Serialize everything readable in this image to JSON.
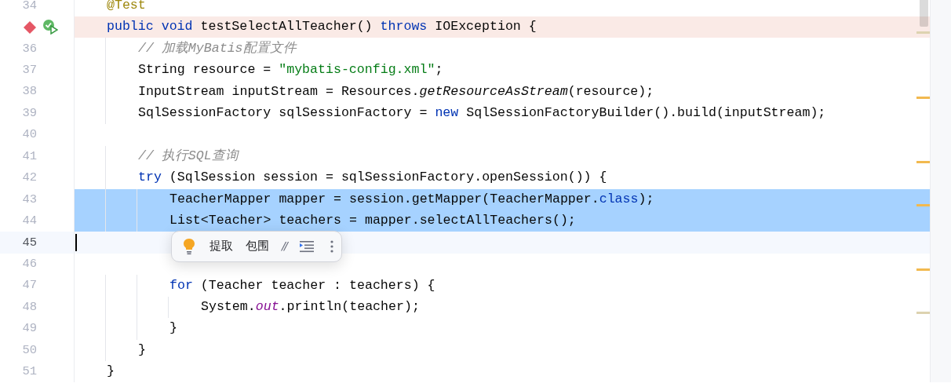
{
  "editor": {
    "lines": [
      {
        "number": "34",
        "selected": false,
        "current": false,
        "breakpoint": false,
        "tokens": [
          {
            "kind": "annotation",
            "text": "    @Test"
          }
        ]
      },
      {
        "selected": false,
        "current": false,
        "breakpoint": true,
        "runnable": true,
        "stripe_mark": {
          "color": "#ddd3b0"
        },
        "tokens": [
          {
            "kind": "keyword",
            "text": "    public void"
          },
          {
            "kind": "plain",
            "text": " testSelectAllTeacher() "
          },
          {
            "kind": "keyword",
            "text": "throws"
          },
          {
            "kind": "plain",
            "text": " IOException {"
          }
        ]
      },
      {
        "number": "36",
        "selected": false,
        "current": false,
        "breakpoint": false,
        "tokens": [
          {
            "kind": "comment",
            "text": "        // 加载MyBatis配置文件"
          }
        ]
      },
      {
        "number": "37",
        "selected": false,
        "current": false,
        "breakpoint": false,
        "tokens": [
          {
            "kind": "plain",
            "text": "        String resource = "
          },
          {
            "kind": "string",
            "text": "\"mybatis-config.xml\""
          },
          {
            "kind": "plain",
            "text": ";"
          }
        ]
      },
      {
        "number": "38",
        "selected": false,
        "current": false,
        "breakpoint": false,
        "stripe_mark": {
          "color": "#f2b94f"
        },
        "tokens": [
          {
            "kind": "plain",
            "text": "        InputStream inputStream = Resources."
          },
          {
            "kind": "static",
            "text": "getResourceAsStream"
          },
          {
            "kind": "plain",
            "text": "(resource);"
          }
        ]
      },
      {
        "number": "39",
        "selected": false,
        "current": false,
        "breakpoint": false,
        "tokens": [
          {
            "kind": "plain",
            "text": "        SqlSessionFactory sqlSessionFactory = "
          },
          {
            "kind": "keyword",
            "text": "new"
          },
          {
            "kind": "plain",
            "text": " SqlSessionFactoryBuilder().build(inputStream);"
          }
        ]
      },
      {
        "number": "40",
        "selected": false,
        "current": false,
        "breakpoint": false
      },
      {
        "number": "41",
        "selected": false,
        "current": false,
        "breakpoint": false,
        "stripe_mark": {
          "color": "#f2b94f"
        },
        "tokens": [
          {
            "kind": "comment",
            "text": "        // 执行SQL查询"
          }
        ]
      },
      {
        "number": "42",
        "selected": false,
        "current": false,
        "breakpoint": false,
        "tokens": [
          {
            "kind": "keyword",
            "text": "        try"
          },
          {
            "kind": "plain",
            "text": " (SqlSession session = sqlSessionFactory.openSession()) {"
          }
        ]
      },
      {
        "number": "43",
        "selected": true,
        "current": false,
        "breakpoint": false,
        "stripe_mark": {
          "color": "#f2b94f"
        },
        "tokens": [
          {
            "kind": "plain",
            "text": "            TeacherMapper mapper = session.getMapper(TeacherMapper."
          },
          {
            "kind": "keyword",
            "text": "class"
          },
          {
            "kind": "plain",
            "text": ");"
          }
        ]
      },
      {
        "number": "44",
        "selected": true,
        "current": false,
        "breakpoint": false,
        "tokens": [
          {
            "kind": "plain",
            "text": "            List<Teacher> teachers = mapper.selectAllTeachers();"
          }
        ]
      },
      {
        "number": "45",
        "selected": false,
        "current": true,
        "breakpoint": false
      },
      {
        "number": "46",
        "selected": false,
        "current": false,
        "breakpoint": false,
        "stripe_mark": {
          "color": "#f2b94f"
        }
      },
      {
        "number": "47",
        "selected": false,
        "current": false,
        "breakpoint": false,
        "tokens": [
          {
            "kind": "keyword",
            "text": "            for"
          },
          {
            "kind": "plain",
            "text": " (Teacher teacher : teachers) {"
          }
        ]
      },
      {
        "number": "48",
        "selected": false,
        "current": false,
        "breakpoint": false,
        "stripe_mark": {
          "color": "#ddd3b0"
        },
        "tokens": [
          {
            "kind": "plain",
            "text": "                System."
          },
          {
            "kind": "field",
            "text": "out"
          },
          {
            "kind": "plain",
            "text": ".println(teacher);"
          }
        ]
      },
      {
        "number": "49",
        "selected": false,
        "current": false,
        "breakpoint": false,
        "tokens": [
          {
            "kind": "plain",
            "text": "            }"
          }
        ]
      },
      {
        "number": "50",
        "selected": false,
        "current": false,
        "breakpoint": false,
        "tokens": [
          {
            "kind": "plain",
            "text": "        }"
          }
        ]
      },
      {
        "number": "51",
        "selected": false,
        "current": false,
        "breakpoint": false,
        "tokens": [
          {
            "kind": "plain",
            "text": "    }"
          }
        ]
      }
    ]
  },
  "popup": {
    "actions": [
      "提取",
      "包围",
      "//"
    ]
  }
}
